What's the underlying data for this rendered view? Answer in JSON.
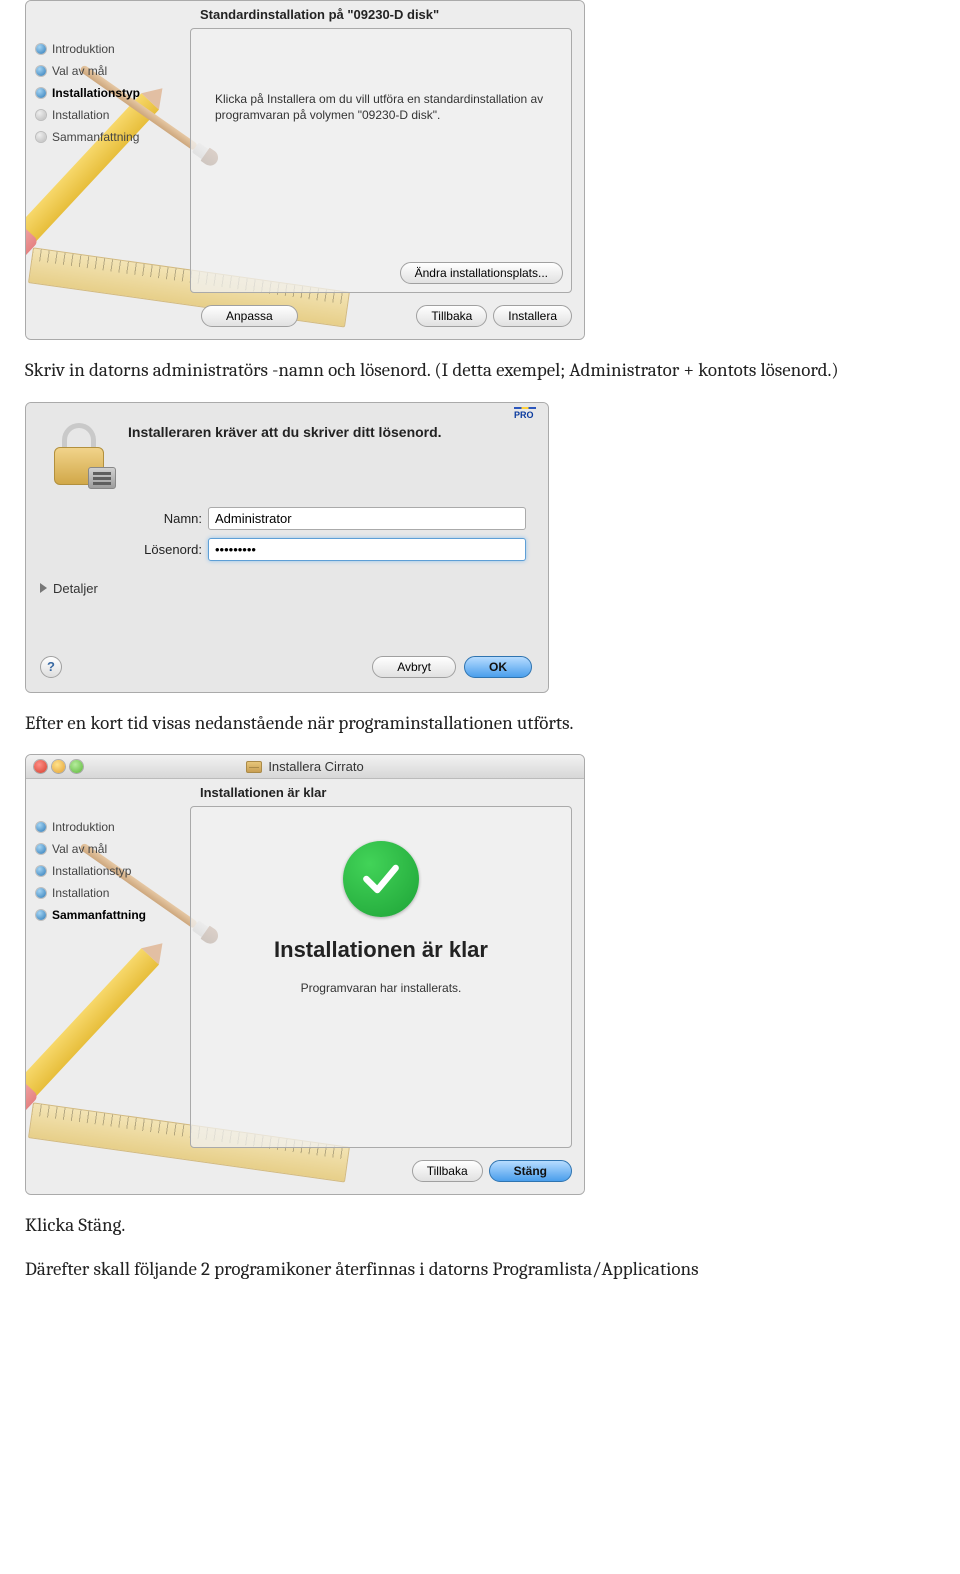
{
  "screenshot1": {
    "subtitle": "Standardinstallation på \"09230-D  disk\"",
    "sidebar": [
      {
        "label": "Introduktion",
        "state": "done"
      },
      {
        "label": "Val av mål",
        "state": "done"
      },
      {
        "label": "Installationstyp",
        "state": "current"
      },
      {
        "label": "Installation",
        "state": "future"
      },
      {
        "label": "Sammanfattning",
        "state": "future"
      }
    ],
    "content_text": "Klicka på Installera om du vill utföra en standardinstallation av programvaran på volymen \"09230-D  disk\".",
    "change_location_btn": "Ändra installationsplats...",
    "buttons": {
      "customize": "Anpassa",
      "back": "Tillbaka",
      "install": "Installera"
    }
  },
  "paragraph1": "Skriv in datorns administratörs -namn och lösenord. (I detta exempel; Administrator + kontots lösenord.)",
  "auth": {
    "badge": "PRO",
    "message": "Installeraren kräver att du skriver ditt lösenord.",
    "name_label": "Namn:",
    "name_value": "Administrator",
    "password_label": "Lösenord:",
    "password_value": "•••••••••",
    "details_label": "Detaljer",
    "help_tooltip": "?",
    "cancel": "Avbryt",
    "ok": "OK"
  },
  "paragraph2": "Efter en kort tid visas nedanstående när programinstallationen utförts.",
  "screenshot3": {
    "title": "Installera Cirrato",
    "subtitle": "Installationen är klar",
    "sidebar": [
      {
        "label": "Introduktion",
        "state": "done"
      },
      {
        "label": "Val av mål",
        "state": "done"
      },
      {
        "label": "Installationstyp",
        "state": "done"
      },
      {
        "label": "Installation",
        "state": "done"
      },
      {
        "label": "Sammanfattning",
        "state": "current"
      }
    ],
    "done_title": "Installationen är klar",
    "done_subtitle": "Programvaran har installerats.",
    "back": "Tillbaka",
    "close": "Stäng"
  },
  "paragraph3": "Klicka Stäng.",
  "paragraph4": "Därefter skall följande 2 programikoner återfinnas i datorns Programlista/Applications"
}
